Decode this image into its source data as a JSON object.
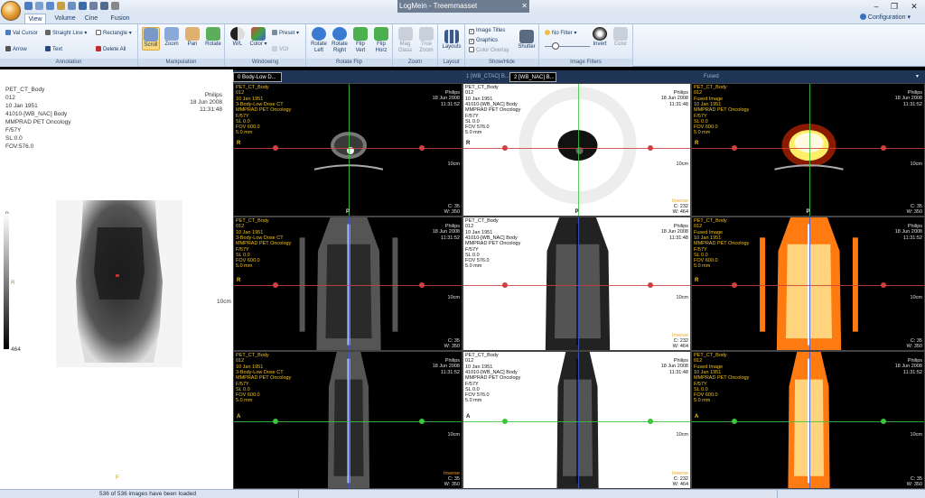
{
  "window": {
    "title": "LogMein - Treemmasset",
    "title_ghost": "CTrmasset",
    "close_glyph": "✕",
    "minimize_glyph": "–",
    "restore_glyph": "❐",
    "close_main_glyph": "✕"
  },
  "tabs": {
    "view": "View",
    "volume": "Volume",
    "cine": "Cine",
    "fusion": "Fusion"
  },
  "configuration": "Configuration",
  "ribbon": {
    "annotation": {
      "label": "Annotation",
      "val_cursor": "Val Cursor",
      "straight_line": "Straight Line",
      "rectangle": "Rectangle",
      "arrow": "Arrow",
      "text": "Text",
      "delete_all": "Delete All"
    },
    "manipulation": {
      "label": "Manipulation",
      "scroll": "Scroll",
      "zoom": "Zoom",
      "pan": "Pan",
      "rotate": "Rotate"
    },
    "windowing": {
      "label": "Windowing",
      "wl": "W/L",
      "color": "Color",
      "preset": "Preset",
      "voi": "VOI"
    },
    "rotate_flip": {
      "label": "Rotate Flip",
      "rotate_left_1": "Rotate",
      "rotate_left_2": "Left",
      "rotate_right_1": "Rotate",
      "rotate_right_2": "Right",
      "flip_vert_1": "Flip",
      "flip_vert_2": "Vert",
      "flip_horz_1": "Flip",
      "flip_horz_2": "Horz"
    },
    "zoom": {
      "label": "Zoom",
      "mag_glass_1": "Mag",
      "mag_glass_2": "Glass",
      "true_zoom_1": "True",
      "true_zoom_2": "Zoom"
    },
    "layout": {
      "label": "Layout",
      "layouts": "Layouts"
    },
    "show_hide": {
      "label": "Show/Hide",
      "image_titles": "Image Titles",
      "graphics": "Graphics",
      "color_overlay": "Color Overlay",
      "shutter": "Shutter"
    },
    "filters": {
      "label": "Image Filters",
      "no_filter": "No Filter",
      "invert": "Invert",
      "color": "Color"
    }
  },
  "left_panel": {
    "lines": [
      "PET_CT_Body",
      "012",
      "10 Jan 1951",
      "41010-[WB_NAC] Body",
      "MMPRAD PET Oncology",
      "F/57Y",
      "SL:0.0",
      "FOV:576.0"
    ],
    "right_lines": [
      "Philips",
      "18 Jun 2008",
      "11:31:48"
    ],
    "scale_top": "0",
    "scale_bottom": "464",
    "orient_r": "R",
    "scale_label": "10cm",
    "bottom_orient": "F"
  },
  "columns": [
    {
      "header": "0 Body-Low D..."
    },
    {
      "header": "1 [WB_CTAC] B..."
    },
    {
      "header": "2 [WB_NAC] B..."
    },
    {
      "header": "Fused"
    }
  ],
  "viewports": {
    "ct_axial": {
      "lines": [
        "PET_CT_Body",
        "012",
        "10 Jan 1951",
        "3-Body-Low Dose CT",
        "MMPRAD PET Oncology",
        "F/57Y",
        "SL 0.0",
        "FOV 600.0",
        "5.0 mm"
      ],
      "right": [
        "Philips",
        "18 Jun 2008",
        "11:31:52"
      ],
      "orient_left": "R",
      "orient_bottom": "P",
      "scale": "10cm",
      "wl_c": "C: 35",
      "wl_w": "W: 350",
      "extra": ""
    },
    "pet_axial": {
      "lines": [
        "PET_CT_Body",
        "012",
        "10 Jan 1951",
        "41010-[WB_NAC] Body",
        "MMPRAD PET Oncology",
        "F/57Y",
        "SL 0.0",
        "FOV 576.0",
        "5.0 mm"
      ],
      "right": [
        "Philips",
        "18 Jun 2008",
        "11:31:48"
      ],
      "orient_left": "R",
      "orient_bottom": "P",
      "scale": "10cm",
      "wl_c": "C: 232",
      "wl_w": "W: 464",
      "extra": "Inverse"
    },
    "fused_axial": {
      "lines": [
        "PET_CT_Body",
        "012",
        "Fused Image",
        "10 Jan 1951",
        "MMPRAD PET Oncology",
        "F/57Y",
        "SL 0.0",
        "FOV 600.0",
        "5.0 mm"
      ],
      "right": [
        "Philips",
        "18 Jun 2008",
        "11:31:52"
      ],
      "orient_left": "R",
      "orient_bottom": "P",
      "scale": "10cm",
      "wl_c": "C: 35",
      "wl_w": "W: 350",
      "extra": ""
    },
    "ct_coronal": {
      "lines": [
        "PET_CT_Body",
        "012",
        "10 Jan 1951",
        "3-Body-Low Dose CT",
        "MMPRAD PET Oncology",
        "F/57Y",
        "SL 0.0",
        "FOV 600.0",
        "5.0 mm"
      ],
      "right": [
        "Philips",
        "18 Jun 2008",
        "11:31:52"
      ],
      "orient_left": "R",
      "orient_bottom": "",
      "scale": "10cm",
      "wl_c": "C: 35",
      "wl_w": "W: 350",
      "extra": ""
    },
    "pet_coronal": {
      "lines": [
        "PET_CT_Body",
        "012",
        "10 Jan 1951",
        "41010-[WB_NAC] Body",
        "MMPRAD PET Oncology",
        "F/57Y",
        "SL 0.0",
        "FOV 576.0",
        "5.0 mm"
      ],
      "right": [
        "Philips",
        "18 Jun 2008",
        "11:31:48"
      ],
      "orient_left": "",
      "orient_bottom": "",
      "scale": "10cm",
      "wl_c": "C: 232",
      "wl_w": "W: 464",
      "extra": "Inverse"
    },
    "fused_coronal": {
      "lines": [
        "PET_CT_Body",
        "012",
        "Fused Image",
        "10 Jan 1951",
        "MMPRAD PET Oncology",
        "F/57Y",
        "SL 0.0",
        "FOV 600.0",
        "5.0 mm"
      ],
      "right": [
        "Philips",
        "18 Jun 2008",
        "11:31:52"
      ],
      "orient_left": "R",
      "orient_bottom": "",
      "scale": "10cm",
      "wl_c": "C: 35",
      "wl_w": "W: 350",
      "extra": ""
    },
    "ct_sagittal": {
      "lines": [
        "PET_CT_Body",
        "012",
        "10 Jan 1951",
        "3-Body-Low Dose CT",
        "MMPRAD PET Oncology",
        "F/57Y",
        "SL 0.0",
        "FOV 600.0",
        "5.0 mm"
      ],
      "right": [
        "Philips",
        "18 Jun 2008",
        "11:31:52"
      ],
      "orient_left": "A",
      "orient_bottom": "",
      "scale": "10cm",
      "wl_c": "C: 35",
      "wl_w": "W: 350",
      "extra": "Inverse"
    },
    "pet_sagittal": {
      "lines": [
        "PET_CT_Body",
        "012",
        "10 Jan 1951",
        "41010-[WB_NAC] Body",
        "MMPRAD PET Oncology",
        "F/57Y",
        "SL 0.0",
        "FOV 576.0",
        "5.0 mm"
      ],
      "right": [
        "Philips",
        "18 Jun 2008",
        "11:31:48"
      ],
      "orient_left": "A",
      "orient_bottom": "",
      "scale": "10cm",
      "wl_c": "C: 232",
      "wl_w": "W: 464",
      "extra": "Inverse"
    },
    "fused_sagittal": {
      "lines": [
        "PET_CT_Body",
        "012",
        "Fused Image",
        "10 Jan 1951",
        "MMPRAD PET Oncology",
        "F/57Y",
        "SL 0.0",
        "FOV 600.0",
        "5.0 mm"
      ],
      "right": [
        "Philips",
        "18 Jun 2008",
        "11:31:52"
      ],
      "orient_left": "A",
      "orient_bottom": "",
      "scale": "10cm",
      "wl_c": "C: 35",
      "wl_w": "W: 350",
      "extra": ""
    }
  },
  "status": {
    "message": "536 of 536 images have been loaded"
  },
  "colors": {
    "ribbon_bg": "#dbe6f4",
    "header_blue": "#1e3556",
    "crosshair_red": "#d04040",
    "crosshair_green": "#3cc43c",
    "crosshair_blue": "#3c5ad8"
  }
}
